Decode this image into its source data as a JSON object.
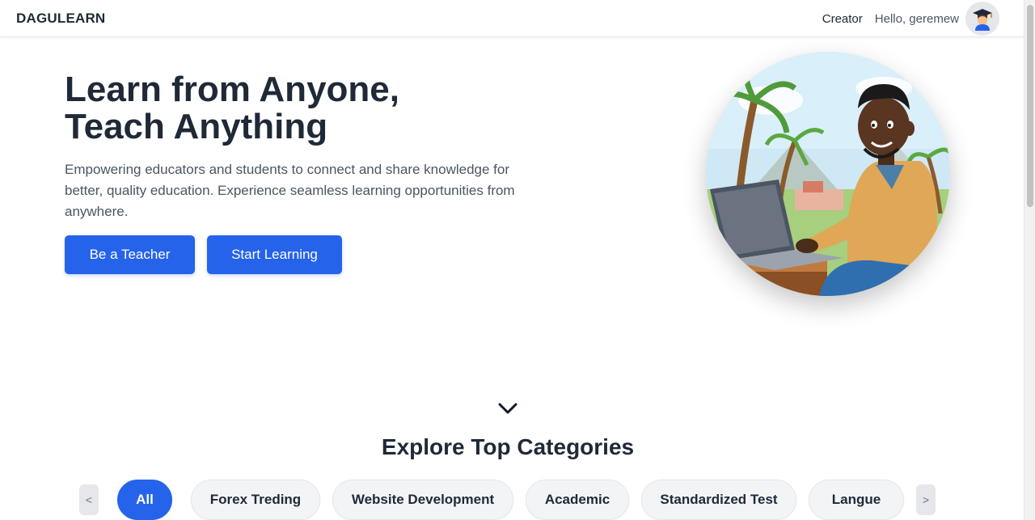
{
  "nav": {
    "brand": "DAGULEARN",
    "creator_link": "Creator",
    "greeting": "Hello, geremew"
  },
  "hero": {
    "title_line1": "Learn from Anyone,",
    "title_line2": "Teach Anything",
    "subtitle": "Empowering educators and students to connect and share knowledge for better, quality education. Experience seamless learning opportunities from anywhere.",
    "primary_button": "Be a Teacher",
    "secondary_button": "Start Learning"
  },
  "categories": {
    "title": "Explore Top Categories",
    "prev_label": "<",
    "next_label": ">",
    "items": [
      "All",
      "Forex Treding",
      "Website Development",
      "Academic",
      "Standardized Test",
      "Langue"
    ],
    "selected": "All"
  },
  "colors": {
    "accent": "#2563eb",
    "text": "#1f2937",
    "muted": "#4b5563"
  }
}
